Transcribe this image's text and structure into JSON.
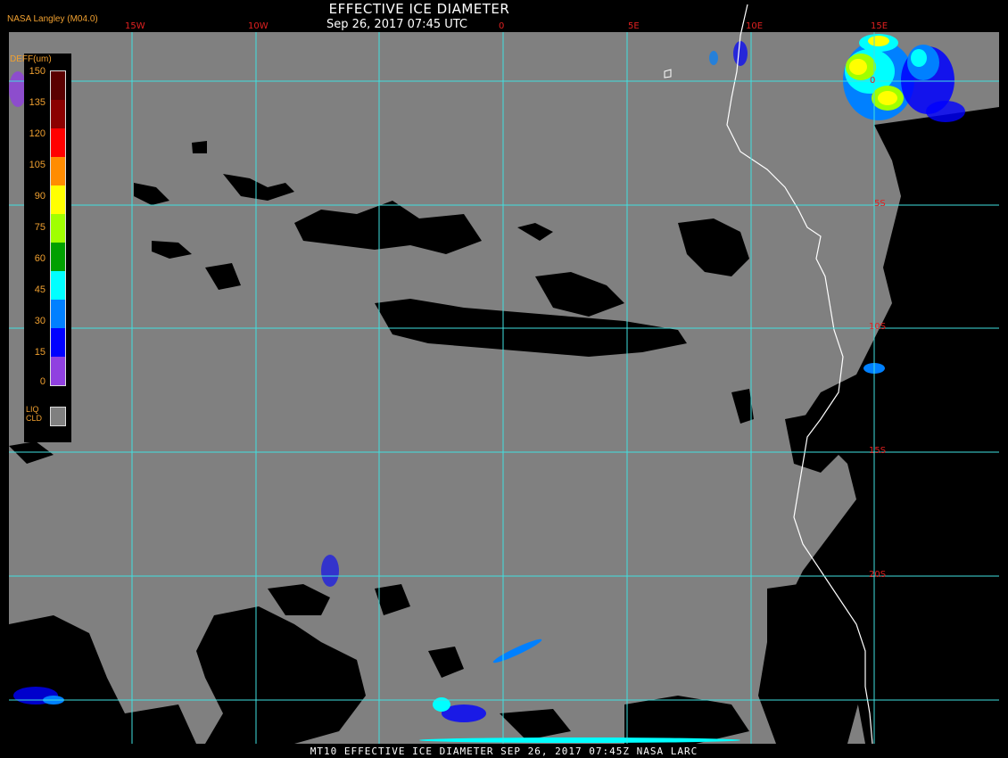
{
  "header": {
    "title": "EFFECTIVE ICE DIAMETER",
    "datetime": "Sep 26, 2017 07:45 UTC",
    "source": "NASA Langley (M04.0)"
  },
  "footer": {
    "text": "MT10  EFFECTIVE ICE DIAMETER  SEP 26, 2017 07:45Z  NASA LARC"
  },
  "legend": {
    "title": "DEFF(um)",
    "ticks": [
      "150",
      "135",
      "120",
      "105",
      "90",
      "75",
      "60",
      "45",
      "30",
      "15",
      "0"
    ],
    "liquid_label_1": "LIQ",
    "liquid_label_2": "CLD",
    "liquid_color": "#808080",
    "colors": [
      "#5a0000",
      "#8b0000",
      "#ff0000",
      "#ff8c00",
      "#ffff00",
      "#a0ff00",
      "#00a000",
      "#00ffff",
      "#0080ff",
      "#0000ff",
      "#9040e0"
    ]
  },
  "map": {
    "lon_labels": [
      {
        "text": "15W"
      },
      {
        "text": "10W"
      },
      {
        "text": "0"
      },
      {
        "text": "5E"
      },
      {
        "text": "10E"
      },
      {
        "text": "15E"
      }
    ],
    "lat_labels": [
      {
        "text": "0"
      },
      {
        "text": "5S"
      },
      {
        "text": "10S"
      },
      {
        "text": "15S"
      },
      {
        "text": "20S"
      }
    ],
    "background_color": "#808080",
    "clear_color": "#000000",
    "grid_color": "#40e0e0",
    "coast_color": "#ffffff"
  }
}
